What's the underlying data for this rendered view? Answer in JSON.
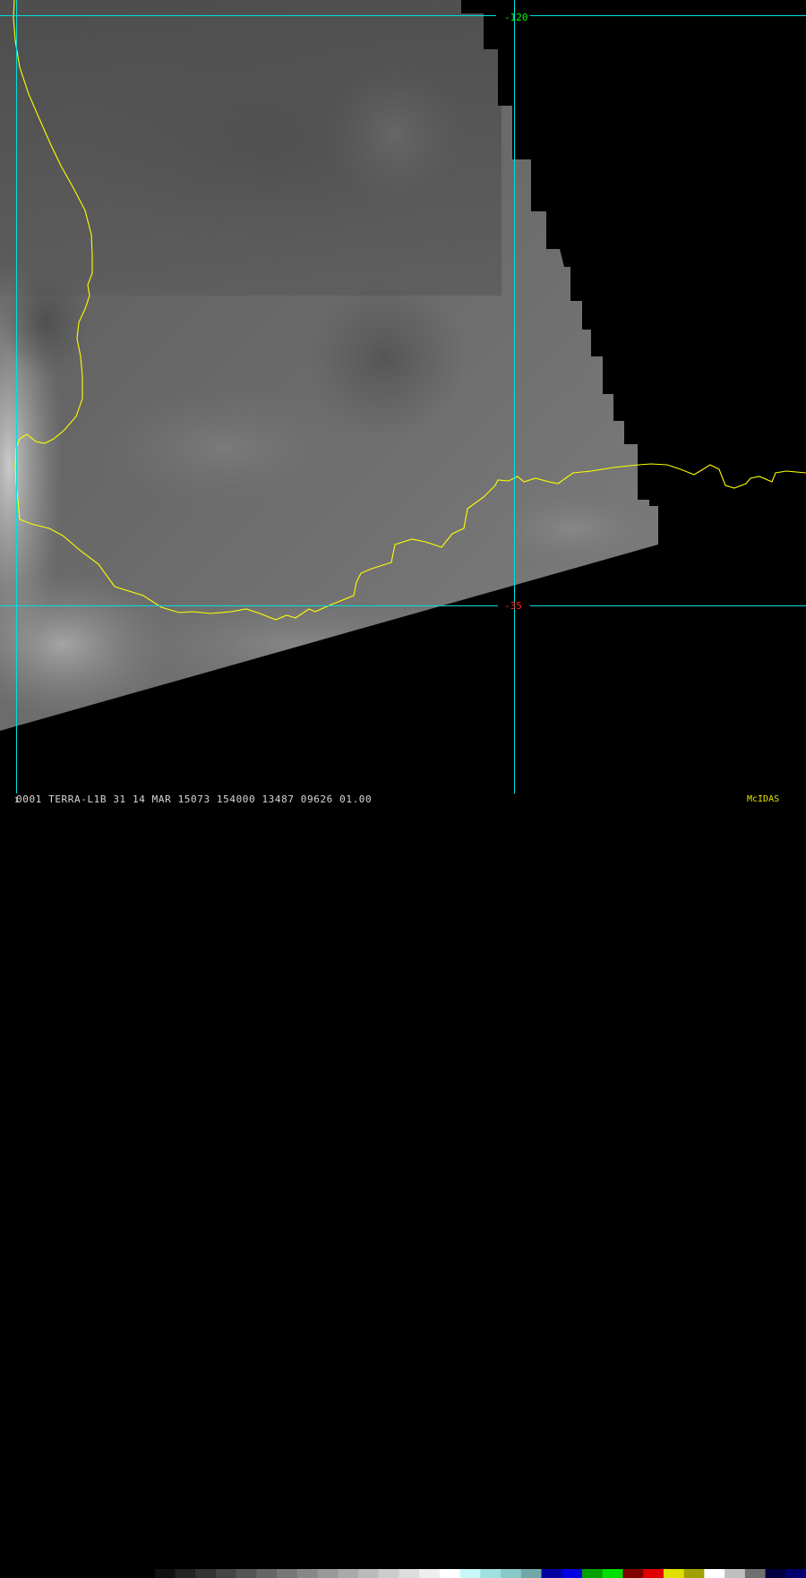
{
  "image": {
    "title": "TERRA-L1B band 31 IR image",
    "colors": {
      "background": "#000000",
      "coastline": "#ffff00",
      "gridline": "#00e0e0",
      "longitude_label": "#00ff00",
      "latitude_label": "#ff2020",
      "logo": "#e8e800"
    }
  },
  "grid": {
    "longitude_label": "-120",
    "latitude_label": "-35"
  },
  "status_bar": {
    "frame_digit": "1",
    "text": "0001 TERRA-L1B 31 14 MAR 15073 154000 13487 09626 01.00",
    "logo": "McIDAS"
  },
  "colorbar": {
    "segments": [
      {
        "color": "#000000"
      },
      {
        "color": "#111111"
      },
      {
        "color": "#222222"
      },
      {
        "color": "#333333"
      },
      {
        "color": "#444444"
      },
      {
        "color": "#555555"
      },
      {
        "color": "#666666"
      },
      {
        "color": "#777777"
      },
      {
        "color": "#888888"
      },
      {
        "color": "#999999"
      },
      {
        "color": "#aaaaaa"
      },
      {
        "color": "#bbbbbb"
      },
      {
        "color": "#cccccc"
      },
      {
        "color": "#dddddd"
      },
      {
        "color": "#eeeeee"
      },
      {
        "color": "#ffffff"
      },
      {
        "color": "#c8f8f8"
      },
      {
        "color": "#a0e0e0"
      },
      {
        "color": "#88c8c8"
      },
      {
        "color": "#70a8a8"
      },
      {
        "color": "#0000a0"
      },
      {
        "color": "#0000e0"
      },
      {
        "color": "#00a000"
      },
      {
        "color": "#00e000"
      },
      {
        "color": "#800000"
      },
      {
        "color": "#e00000"
      },
      {
        "color": "#e0e000"
      },
      {
        "color": "#a0a000"
      },
      {
        "color": "#ffffff"
      },
      {
        "color": "#c0c0c0"
      },
      {
        "color": "#707070"
      },
      {
        "color": "#000040"
      },
      {
        "color": "#000070"
      }
    ]
  }
}
